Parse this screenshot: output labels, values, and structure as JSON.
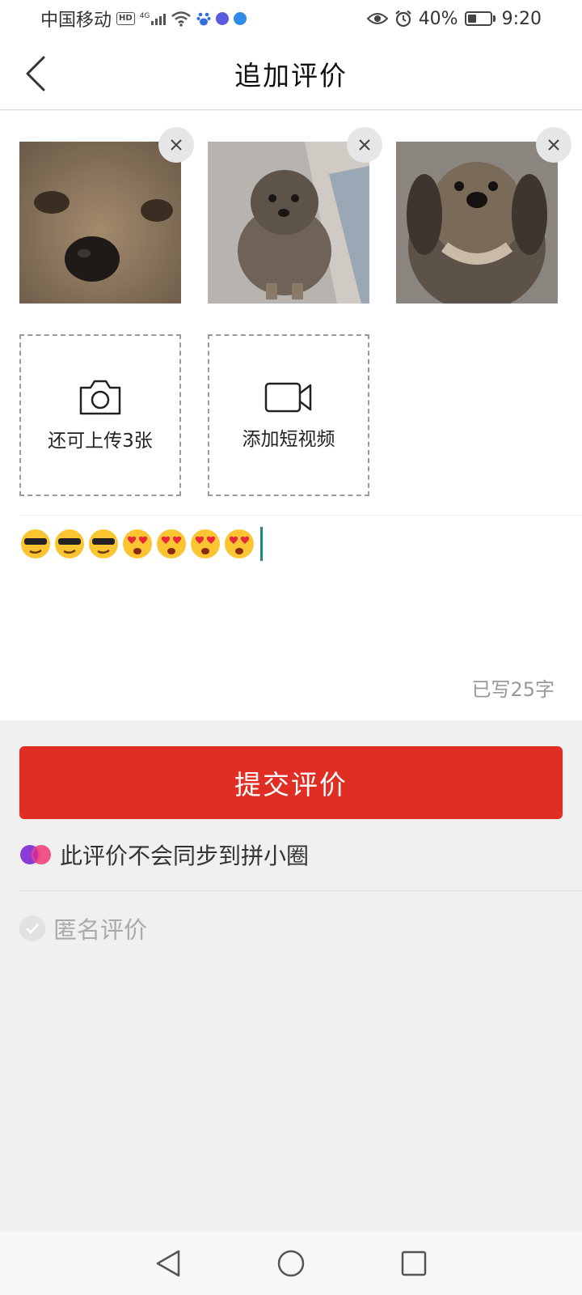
{
  "status_bar": {
    "carrier": "中国移动",
    "hd_badge": "HD",
    "network": "4G",
    "battery_percent": "40%",
    "battery_level": 0.4,
    "time": "9:20",
    "icons": [
      "hd-icon",
      "signal-icon",
      "wifi-icon",
      "paw-app-icon",
      "music-app-icon",
      "browser-app-icon",
      "eye-icon",
      "alarm-icon",
      "battery-icon"
    ]
  },
  "header": {
    "title": "追加评价",
    "back_icon": "back-arrow-icon"
  },
  "photos": [
    {
      "name": "dog-closeup-photo"
    },
    {
      "name": "dog-sitting-photo"
    },
    {
      "name": "dog-portrait-photo"
    }
  ],
  "upload": {
    "photo_label": "还可上传3张",
    "photo_icon": "camera-icon",
    "video_label": "添加短视频",
    "video_icon": "video-camera-icon"
  },
  "review": {
    "emojis": [
      "cool-face",
      "cool-face",
      "cool-face",
      "heart-eyes-face",
      "heart-eyes-face",
      "heart-eyes-face",
      "heart-eyes-face"
    ],
    "char_count": "已写25字"
  },
  "actions": {
    "submit_label": "提交评价",
    "sync_note": "此评价不会同步到拼小圈",
    "anonymous_label": "匿名评价"
  },
  "colors": {
    "accent": "#e02e24",
    "caret": "#1a8a80",
    "background": "#f0f0f0"
  }
}
